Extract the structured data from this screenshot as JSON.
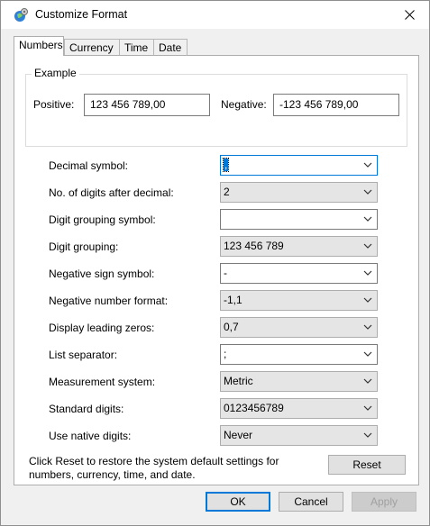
{
  "window": {
    "title": "Customize Format"
  },
  "tabs": [
    {
      "label": "Numbers",
      "active": true
    },
    {
      "label": "Currency",
      "active": false
    },
    {
      "label": "Time",
      "active": false
    },
    {
      "label": "Date",
      "active": false
    }
  ],
  "example": {
    "group_title": "Example",
    "positive_label": "Positive:",
    "positive_value": "123 456 789,00",
    "negative_label": "Negative:",
    "negative_value": "-123 456 789,00"
  },
  "settings": [
    {
      "label": "Decimal symbol:",
      "value": ","
    },
    {
      "label": "No. of digits after decimal:",
      "value": "2"
    },
    {
      "label": "Digit grouping symbol:",
      "value": ""
    },
    {
      "label": "Digit grouping:",
      "value": "123 456 789"
    },
    {
      "label": "Negative sign symbol:",
      "value": "-"
    },
    {
      "label": "Negative number format:",
      "value": "-1,1"
    },
    {
      "label": "Display leading zeros:",
      "value": "0,7"
    },
    {
      "label": "List separator:",
      "value": ";"
    },
    {
      "label": "Measurement system:",
      "value": "Metric"
    },
    {
      "label": "Standard digits:",
      "value": "0123456789"
    },
    {
      "label": "Use native digits:",
      "value": "Never"
    }
  ],
  "reset": {
    "text_line1": "Click Reset to restore the system default settings for",
    "text_line2": "numbers, currency, time, and date.",
    "button_label": "Reset"
  },
  "footer": {
    "ok_label": "OK",
    "cancel_label": "Cancel",
    "apply_label": "Apply"
  },
  "colors": {
    "accent": "#0078d7",
    "window_bg": "#f0f0f0"
  },
  "icons": {
    "app": "region-settings-icon",
    "close": "close-icon",
    "dropdown": "chevron-down-icon"
  }
}
